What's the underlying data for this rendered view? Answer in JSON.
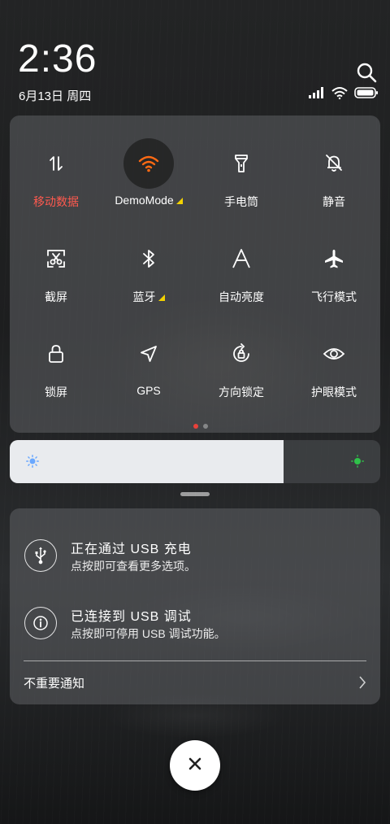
{
  "status": {
    "time": "2:36",
    "date": "6月13日 周四"
  },
  "tiles": [
    {
      "label": "移动数据",
      "icon": "mobile-data-icon",
      "state": "on-red"
    },
    {
      "label": "DemoMode",
      "icon": "wifi-icon",
      "state": "active",
      "has_arrow": true
    },
    {
      "label": "手电筒",
      "icon": "flashlight-icon"
    },
    {
      "label": "静音",
      "icon": "mute-bell-icon"
    },
    {
      "label": "截屏",
      "icon": "screenshot-icon"
    },
    {
      "label": "蓝牙",
      "icon": "bluetooth-icon",
      "has_arrow": true
    },
    {
      "label": "自动亮度",
      "icon": "auto-brightness-icon"
    },
    {
      "label": "飞行模式",
      "icon": "airplane-icon"
    },
    {
      "label": "锁屏",
      "icon": "lock-icon"
    },
    {
      "label": "GPS",
      "icon": "gps-icon"
    },
    {
      "label": "方向锁定",
      "icon": "rotation-lock-icon"
    },
    {
      "label": "护眼模式",
      "icon": "eye-icon"
    }
  ],
  "page_indicator": {
    "pages": 2,
    "current": 1
  },
  "brightness": {
    "level": 0.74
  },
  "notifications": [
    {
      "title": "正在通过 USB 充电",
      "subtitle": "点按即可查看更多选项。",
      "icon": "usb-icon"
    },
    {
      "title": "已连接到 USB 调试",
      "subtitle": "点按即可停用 USB 调试功能。",
      "icon": "info-icon"
    }
  ],
  "unimportant": {
    "label": "不重要通知"
  },
  "colors": {
    "accent_wifi": "#ff6a13",
    "accent_red": "#ff5a4f",
    "brightness_high": "#2fc24a",
    "brightness_low": "#6aa8ff"
  }
}
